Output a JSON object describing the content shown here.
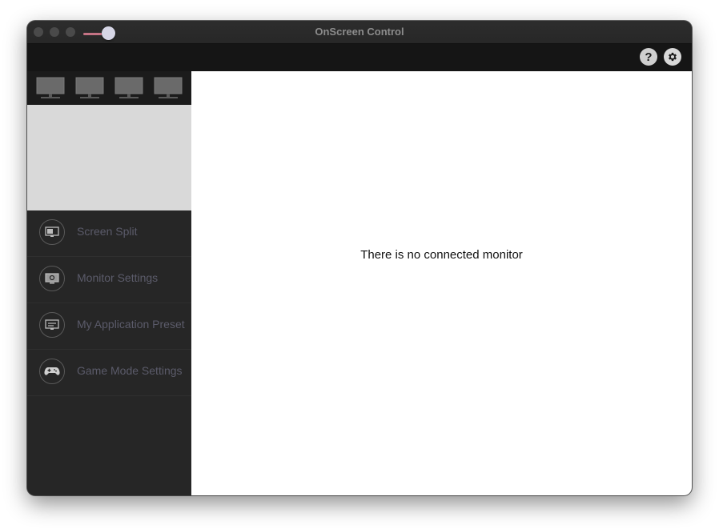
{
  "window": {
    "title": "OnScreen Control"
  },
  "toolbar": {
    "help_glyph": "?",
    "help_icon": "question-icon",
    "settings_icon": "gear-icon"
  },
  "monitor_strip": {
    "icons": [
      "monitor-icon",
      "monitor-icon",
      "monitor-icon",
      "monitor-icon"
    ]
  },
  "sidebar": {
    "items": [
      {
        "label": "Screen Split",
        "icon": "screen-split-icon"
      },
      {
        "label": "Monitor Settings",
        "icon": "monitor-settings-icon"
      },
      {
        "label": "My Application Preset",
        "icon": "application-preset-icon"
      },
      {
        "label": "Game Mode Settings",
        "icon": "gamepad-icon"
      }
    ]
  },
  "main": {
    "message": "There is no connected monitor"
  },
  "colors": {
    "sidebar_bg": "#262626",
    "toolbar_bg": "#151515",
    "preview_bg": "#d9d9d9",
    "menu_label": "#5b5b6a",
    "slider_accent": "#c47384"
  }
}
